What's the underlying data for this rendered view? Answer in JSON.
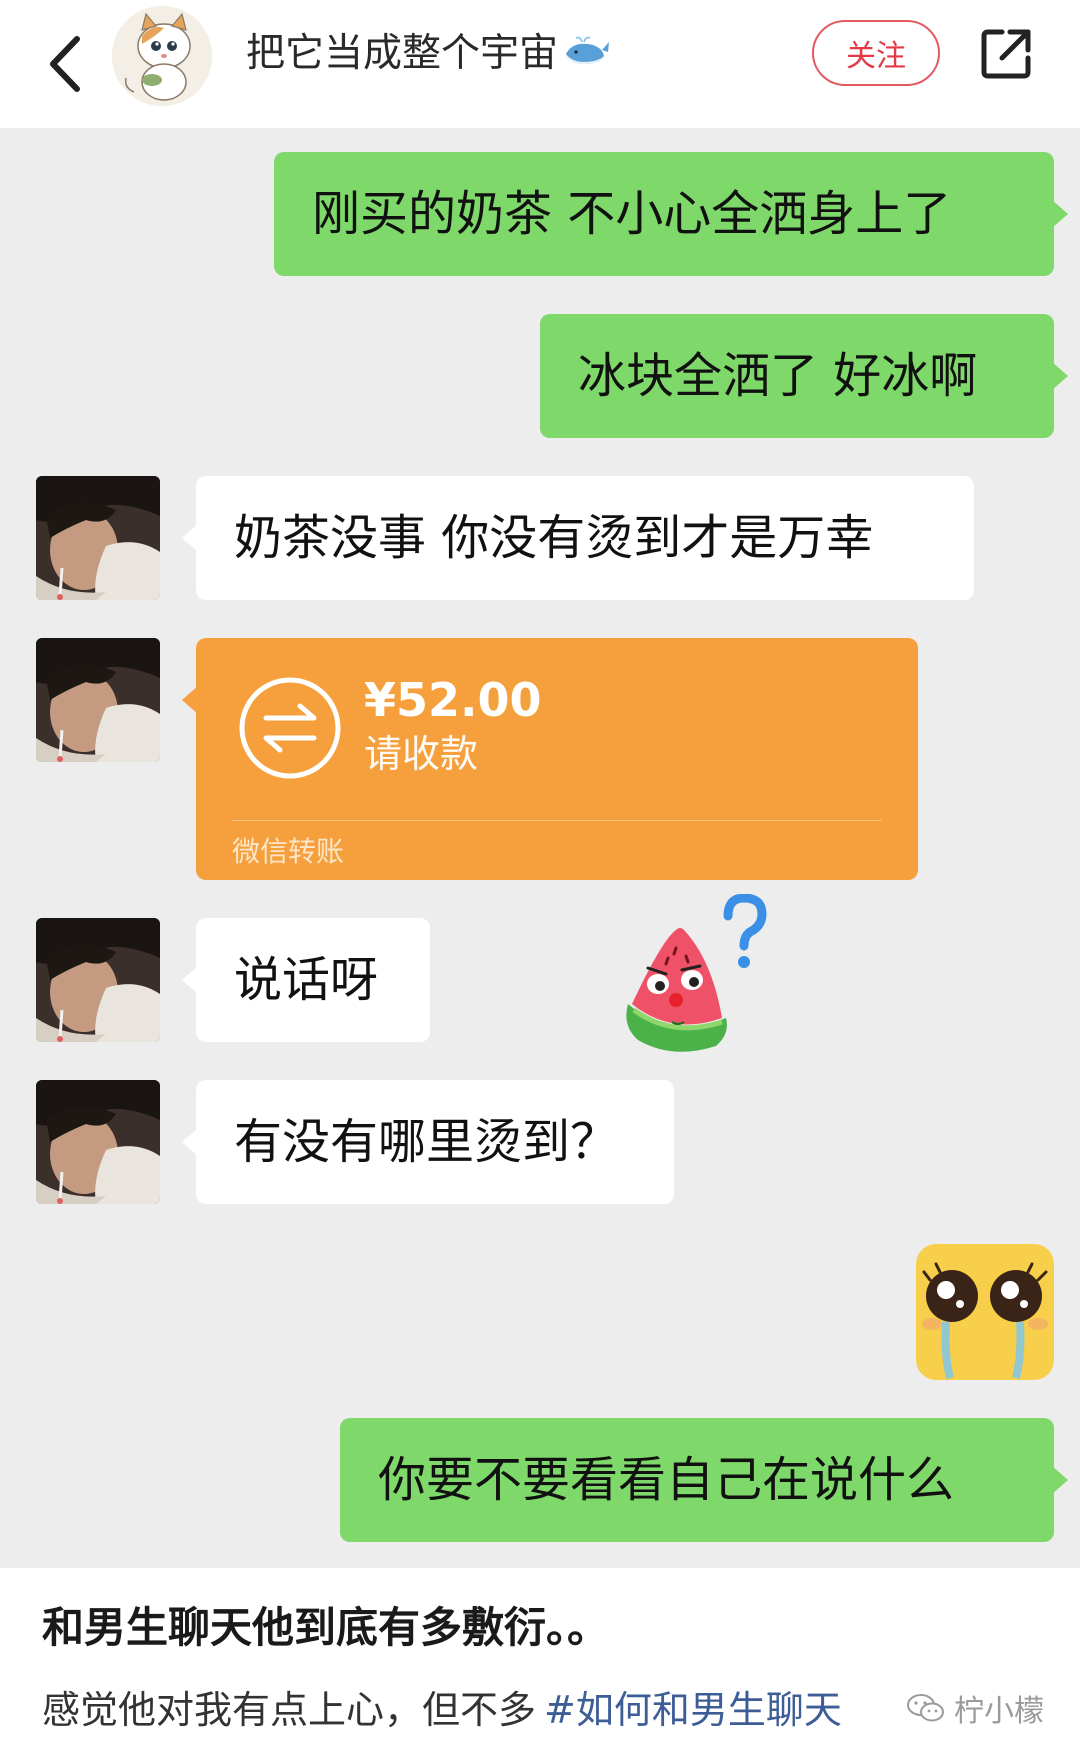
{
  "header": {
    "title": "把它当成整个宇宙",
    "follow_label": "关注"
  },
  "messages": [
    {
      "side": "right",
      "text": "刚买的奶茶 不小心全洒身上了"
    },
    {
      "side": "right",
      "text": "冰块全洒了 好冰啊"
    },
    {
      "side": "left",
      "text": "奶茶没事 你没有烫到才是万幸"
    },
    {
      "side": "left",
      "type": "transfer",
      "amount": "¥52.00",
      "status": "请收款",
      "footer": "微信转账"
    },
    {
      "side": "left",
      "text": "说话呀"
    },
    {
      "side": "left",
      "text": "有没有哪里烫到？"
    },
    {
      "side": "right",
      "text": "你要不要看看自己在说什么"
    }
  ],
  "caption": {
    "title": "和男生聊天他到底有多敷衍。。",
    "body": "感觉他对我有点上心，但不多",
    "hashtag": "#如何和男生聊天",
    "watermark": "柠小檬"
  },
  "colors": {
    "green_bubble": "#7fd86a",
    "white_bubble": "#ffffff",
    "transfer": "#f6a03d",
    "follow_red": "#e23a46",
    "chat_bg": "#ededed",
    "hashtag": "#3d5d97"
  },
  "icons": [
    "back-arrow-icon",
    "share-icon",
    "transfer-icon",
    "question-mark-icon",
    "wechat-icon"
  ]
}
